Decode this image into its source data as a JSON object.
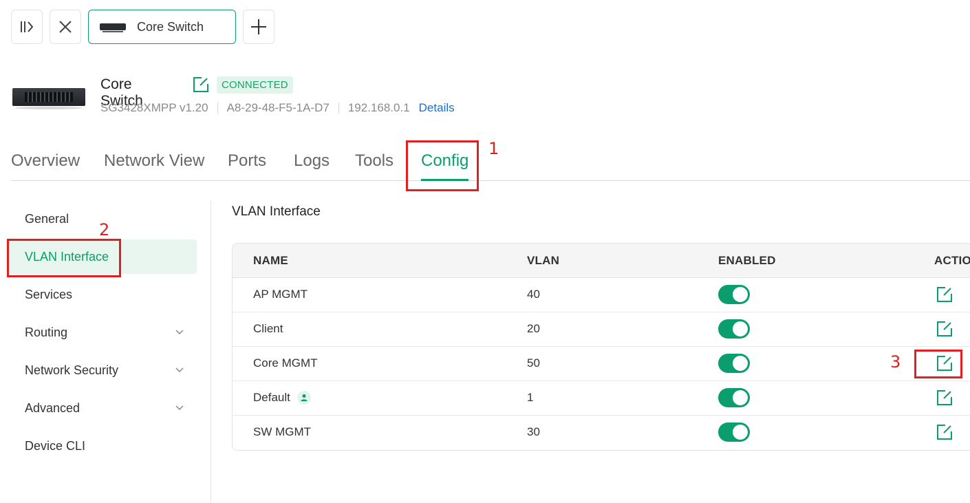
{
  "topbar": {
    "tab_label": "Core Switch"
  },
  "device": {
    "name": "Core Switch",
    "status": "CONNECTED",
    "model": "SG3428XMPP v1.20",
    "mac": "A8-29-48-F5-1A-D7",
    "ip": "192.168.0.1",
    "details_link": "Details"
  },
  "main_tabs": [
    {
      "label": "Overview"
    },
    {
      "label": "Network View"
    },
    {
      "label": "Ports"
    },
    {
      "label": "Logs"
    },
    {
      "label": "Tools"
    },
    {
      "label": "Config",
      "active": true
    }
  ],
  "sidebar": {
    "items": [
      {
        "label": "General"
      },
      {
        "label": "VLAN Interface",
        "active": true
      },
      {
        "label": "Services"
      },
      {
        "label": "Routing",
        "expandable": true
      },
      {
        "label": "Network Security",
        "expandable": true
      },
      {
        "label": "Advanced",
        "expandable": true
      },
      {
        "label": "Device CLI"
      }
    ]
  },
  "section": {
    "title": "VLAN Interface"
  },
  "table": {
    "headers": {
      "name": "NAME",
      "vlan": "VLAN",
      "enabled": "ENABLED",
      "action": "ACTIO"
    },
    "rows": [
      {
        "name": "AP MGMT",
        "vlan": "40",
        "enabled": true
      },
      {
        "name": "Client",
        "vlan": "20",
        "enabled": true
      },
      {
        "name": "Core MGMT",
        "vlan": "50",
        "enabled": true
      },
      {
        "name": "Default",
        "vlan": "1",
        "enabled": true,
        "default_icon": "user-icon"
      },
      {
        "name": "SW MGMT",
        "vlan": "30",
        "enabled": true
      }
    ]
  },
  "annotations": [
    "1",
    "2",
    "3"
  ],
  "colors": {
    "accent": "#0a9e6e",
    "annotation": "#e02020",
    "link": "#1a6fc6"
  }
}
